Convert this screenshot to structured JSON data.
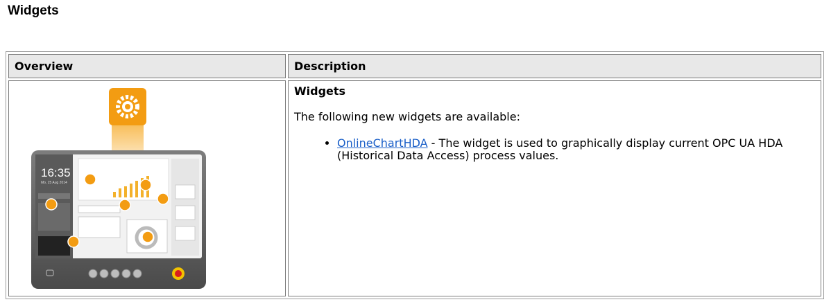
{
  "page": {
    "title": "Widgets"
  },
  "table": {
    "headers": [
      "Overview",
      "Description"
    ],
    "description": {
      "heading": "Widgets",
      "intro": "The following new widgets are available:",
      "items": [
        {
          "link_text": "OnlineChartHDA",
          "text": " - The widget is used to graphically display current OPC UA HDA (Historical Data Access) process values."
        }
      ]
    },
    "illustration": {
      "clock": "16:35",
      "date": "Mo, 25 Aug 2014",
      "accent_color": "#f39c12",
      "icon": "gear-widget-icon"
    }
  }
}
